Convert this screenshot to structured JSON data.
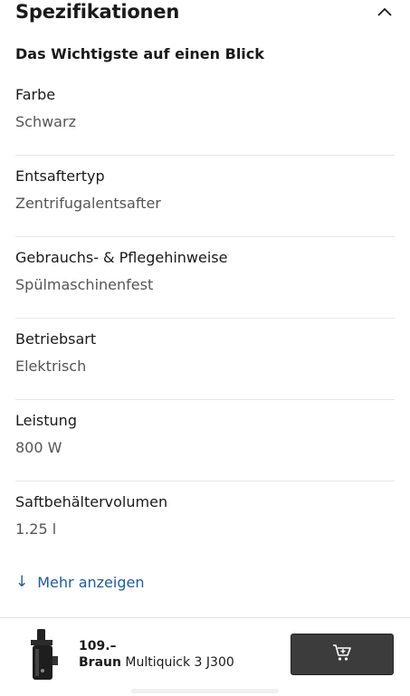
{
  "header": {
    "title": "Spezifikationen",
    "toggle_icon": "chevron-up-icon"
  },
  "section": {
    "heading": "Das Wichtigste auf einen Blick"
  },
  "specs": [
    {
      "label": "Farbe",
      "value": "Schwarz"
    },
    {
      "label": "Entsaftertyp",
      "value": "Zentrifugalentsafter"
    },
    {
      "label": "Gebrauchs- & Pflegehinweise",
      "value": "Spülmaschinenfest"
    },
    {
      "label": "Betriebsart",
      "value": "Elektrisch"
    },
    {
      "label": "Leistung",
      "value": "800 W"
    },
    {
      "label": "Saftbehältervolumen",
      "value": "1.25 l"
    }
  ],
  "show_more": {
    "arrow": "↓",
    "label": "Mehr anzeigen"
  },
  "bottom_bar": {
    "price": "109.–",
    "brand": "Braun",
    "product_name": "Multiquick 3 J300",
    "cart_icon": "shopping-cart-icon"
  },
  "colors": {
    "link": "#1d5aa8",
    "cart_button": "#3c3c3c",
    "divider": "#e6e6e6"
  }
}
